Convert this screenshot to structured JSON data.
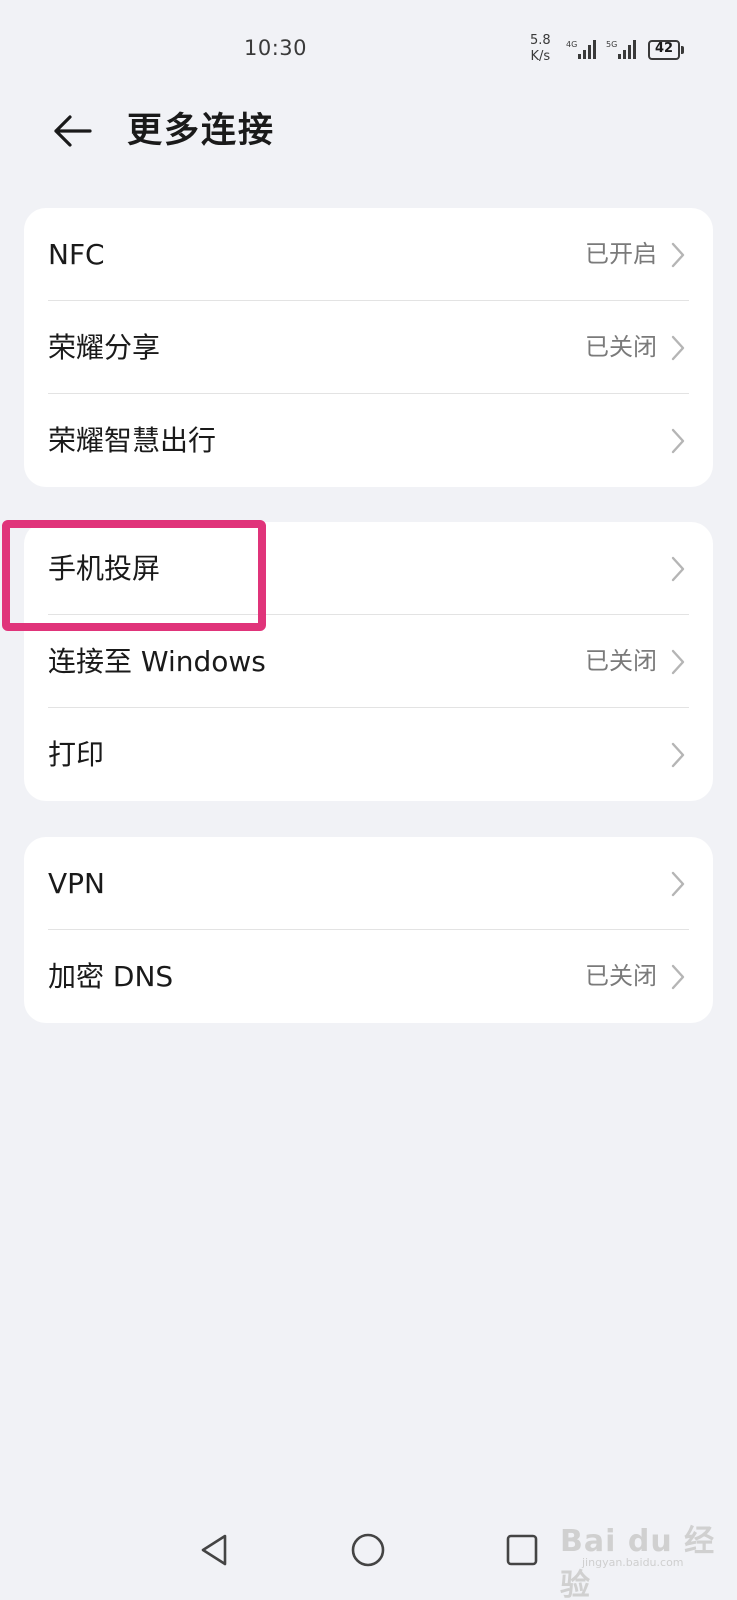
{
  "status_bar": {
    "time": "10:30",
    "net_speed_value": "5.8",
    "net_speed_unit": "K/s",
    "signal_1_label": "4G",
    "signal_2_label": "5G",
    "battery_level": "42"
  },
  "header": {
    "title": "更多连接"
  },
  "groups": [
    {
      "items": [
        {
          "label": "NFC",
          "value": "已开启"
        },
        {
          "label": "荣耀分享",
          "value": "已关闭"
        },
        {
          "label": "荣耀智慧出行",
          "value": ""
        }
      ]
    },
    {
      "items": [
        {
          "label": "手机投屏",
          "value": ""
        },
        {
          "label": "连接至 Windows",
          "value": "已关闭"
        },
        {
          "label": "打印",
          "value": ""
        }
      ]
    },
    {
      "items": [
        {
          "label": "VPN",
          "value": ""
        },
        {
          "label": "加密 DNS",
          "value": "已关闭"
        }
      ]
    }
  ],
  "annotation": {
    "highlight_color": "#e0347a",
    "highlighted_item": "手机投屏"
  },
  "nav_bar": {
    "icons": [
      "back-triangle-icon",
      "home-circle-icon",
      "recent-square-icon"
    ]
  },
  "watermark": {
    "main": "Bai du 经验",
    "sub": "jingyan.baidu.com"
  }
}
